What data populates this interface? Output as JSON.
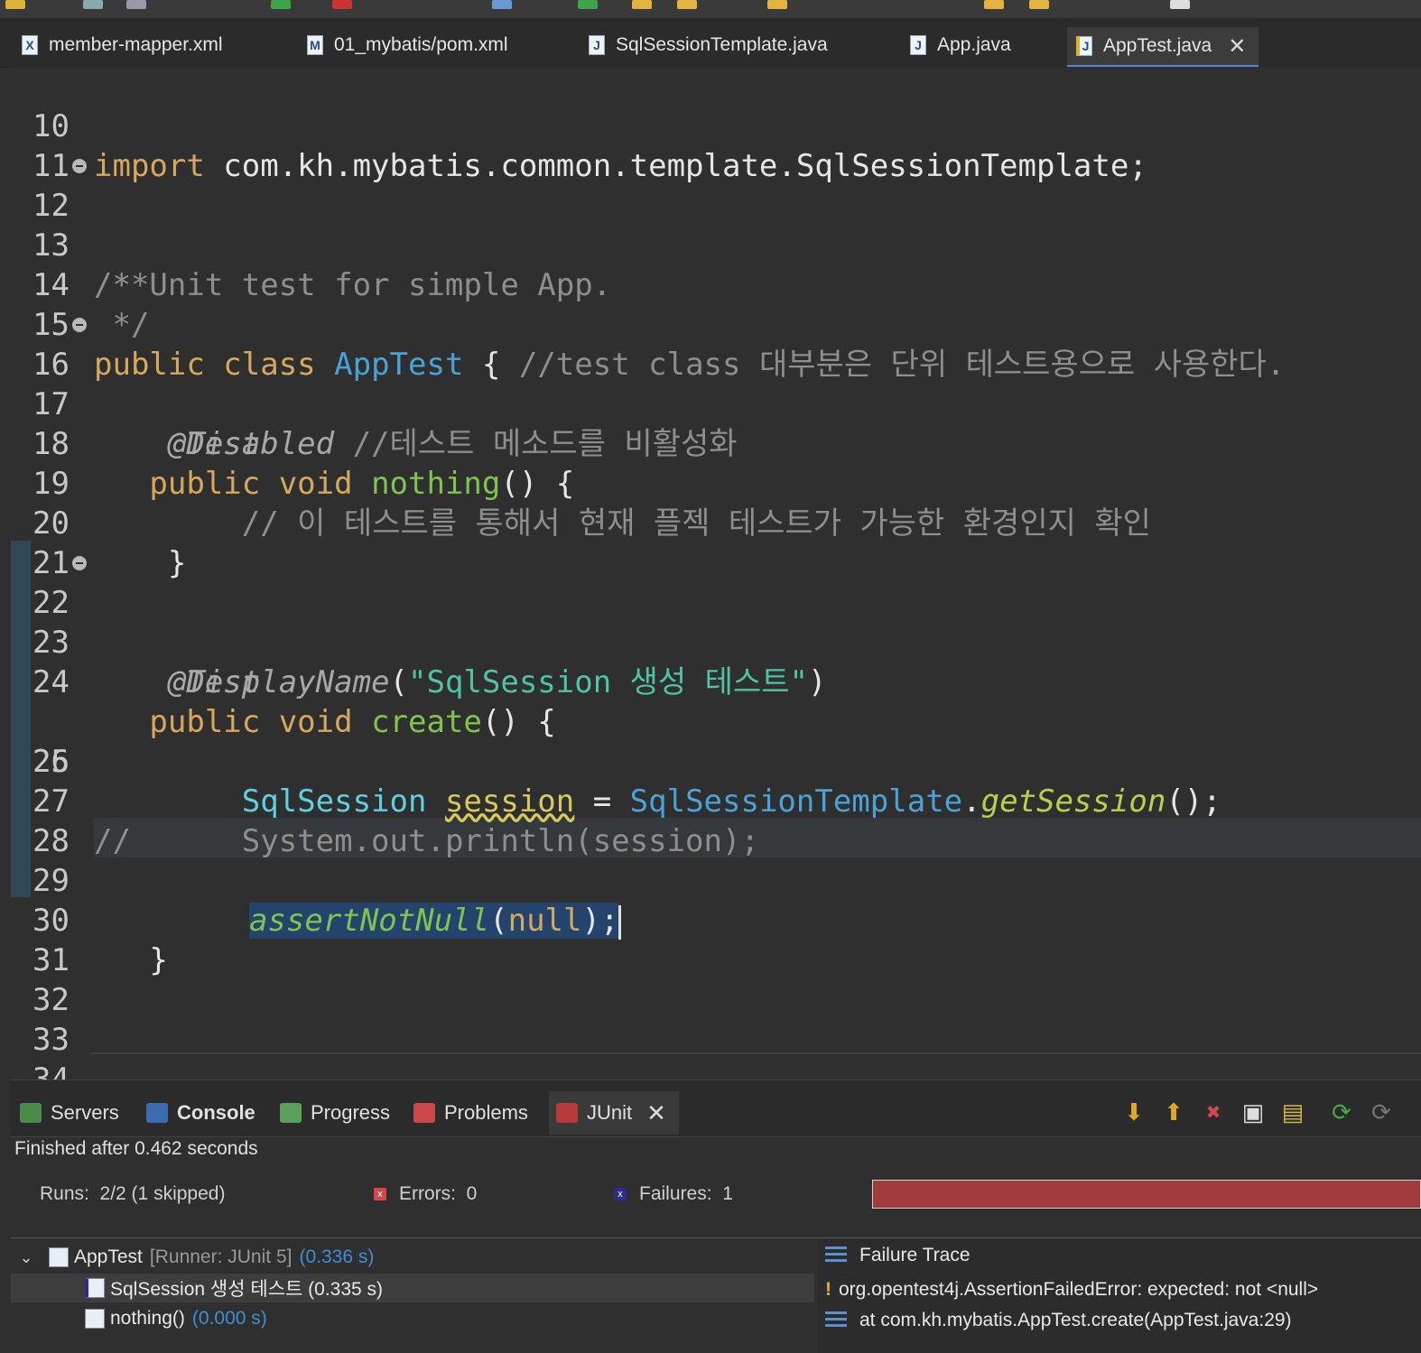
{
  "editor_tabs": [
    {
      "label": "member-mapper.xml",
      "icon": "xml-file-icon"
    },
    {
      "label": "01_mybatis/pom.xml",
      "icon": "maven-file-icon"
    },
    {
      "label": "SqlSessionTemplate.java",
      "icon": "java-file-icon"
    },
    {
      "label": "App.java",
      "icon": "java-file-icon"
    },
    {
      "label": "AppTest.java",
      "icon": "java-file-warning-icon",
      "active": true
    }
  ],
  "code_lines": [
    {
      "n": "10",
      "parts": {
        "a": "import",
        "b": " com.kh.mybatis.common.template.SqlSessionTemplate;"
      }
    },
    {
      "n": "11"
    },
    {
      "n": "12",
      "text": "/**"
    },
    {
      "n": "13",
      "text": " * Unit test for simple App."
    },
    {
      "n": "14",
      "text": " */"
    },
    {
      "n": "15",
      "parts": {
        "a": "public class",
        "b": "AppTest",
        "c": " { ",
        "d": "//test class 대부분은 단위 테스트용으로 사용한다."
      }
    },
    {
      "n": "16",
      "text": "    @Test"
    },
    {
      "n": "17",
      "parts": {
        "a": "    @Disabled",
        "b": " //테스트 메소드를 비활성화"
      }
    },
    {
      "n": "18",
      "parts": {
        "a": "   public void",
        "b": "nothing",
        "c": "() {"
      }
    },
    {
      "n": "19",
      "text": "        // 이 테스트를 통해서 현재 플젝 테스트가 가능한 환경인지 확인"
    },
    {
      "n": "20",
      "text": "    }"
    },
    {
      "n": "21"
    },
    {
      "n": "22",
      "text": "    @Test"
    },
    {
      "n": "23",
      "parts": {
        "a": "    @DisplayName",
        "b": "(",
        "c": "\"SqlSession 생성 테스트\"",
        "d": ")"
      }
    },
    {
      "n": "24",
      "parts": {
        "a": "   public void",
        "b": "create",
        "c": "() {"
      }
    },
    {
      "n": "25",
      "parts": {
        "a": "        SqlSession",
        "b": "session",
        "c": " = ",
        "d": "SqlSessionTemplate",
        "e": ".",
        "f": "getSession",
        "g": "();"
      }
    },
    {
      "n": "26"
    },
    {
      "n": "27",
      "parts": {
        "a": "//",
        "b": "      System.out.println(session);"
      }
    },
    {
      "n": "28"
    },
    {
      "n": "29",
      "parts": {
        "a": "assertNotNull",
        "b": "(",
        "c": "null",
        "d": ");"
      }
    },
    {
      "n": "30",
      "text": "   }"
    },
    {
      "n": "31"
    },
    {
      "n": "32"
    },
    {
      "n": "33"
    },
    {
      "n": "34"
    }
  ],
  "panel_tabs": [
    {
      "label": "Servers",
      "icon": "servers-icon"
    },
    {
      "label": "Console",
      "icon": "console-icon"
    },
    {
      "label": "Progress",
      "icon": "progress-icon"
    },
    {
      "label": "Problems",
      "icon": "problems-icon"
    },
    {
      "label": "JUnit",
      "icon": "junit-icon",
      "active": true
    }
  ],
  "junit": {
    "status": "Finished after 0.462 seconds",
    "runs_label": "Runs:",
    "runs_value": "2/2 (1 skipped)",
    "errors_label": "Errors:",
    "errors_value": "0",
    "failures_label": "Failures:",
    "failures_value": "1",
    "progress_fraction": 1.0,
    "progress_color": "#a23b3b",
    "tree": {
      "root_name": "AppTest",
      "root_runner": "[Runner: JUnit 5]",
      "root_time": "(0.336 s)",
      "items": [
        {
          "label": "SqlSession 생성 테스트 (0.335 s)",
          "status": "failed"
        },
        {
          "label": "nothing()",
          "time": "(0.000 s)",
          "status": "skipped"
        }
      ]
    },
    "failure_trace": {
      "title": "Failure Trace",
      "lines": [
        "org.opentest4j.AssertionFailedError: expected: not <null>",
        "at com.kh.mybatis.AppTest.create(AppTest.java:29)"
      ]
    }
  }
}
